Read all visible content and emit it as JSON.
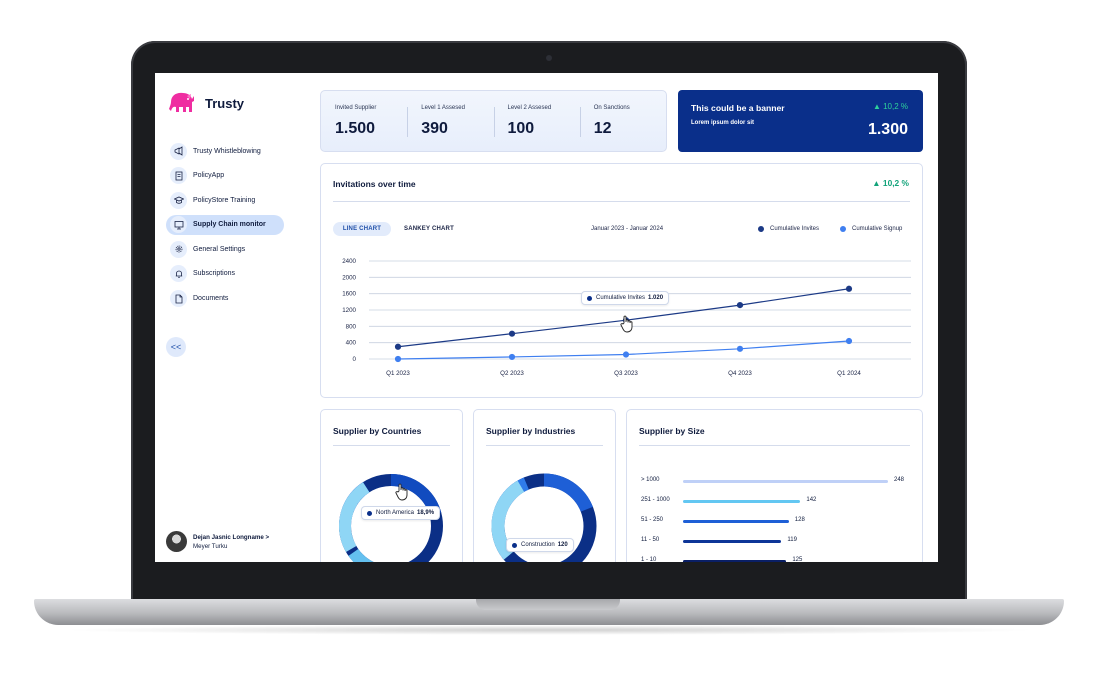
{
  "app": {
    "name": "Trusty"
  },
  "sidebar": {
    "items": [
      {
        "label": "Trusty Whistleblowing",
        "icon": "megaphone-icon",
        "active": false
      },
      {
        "label": "PolicyApp",
        "icon": "document-icon",
        "active": false
      },
      {
        "label": "PolicyStore Training",
        "icon": "graduation-cap-icon",
        "active": false
      },
      {
        "label": "Supply Chain monitor",
        "icon": "monitor-icon",
        "active": true
      },
      {
        "label": "General Settings",
        "icon": "gear-icon",
        "active": false
      },
      {
        "label": "Subscriptions",
        "icon": "bell-icon",
        "active": false
      },
      {
        "label": "Documents",
        "icon": "file-icon",
        "active": false
      }
    ],
    "collapse_label": "<<",
    "user": {
      "name": "Dejan Jasnic Longname >",
      "company": "Meyer Turku"
    }
  },
  "stats": [
    {
      "label": "Invited Supplier",
      "value": "1.500"
    },
    {
      "label": "Level 1 Assesed",
      "value": "390"
    },
    {
      "label": "Level 2 Assesed",
      "value": "100"
    },
    {
      "label": "On Sanctions",
      "value": "12"
    }
  ],
  "banner": {
    "title": "This could be a banner",
    "subtitle": "Lorem ipsum dolor sit",
    "trend": "▲ 10,2 %",
    "value": "1.300"
  },
  "invitations": {
    "title": "Invitations over time",
    "trend": "▲ 10,2 %",
    "tabs": {
      "line": "LINE CHART",
      "sankey": "SANKEY CHART"
    },
    "date_range": "Januar 2023 - Januar 2024",
    "legend": {
      "invites": "Cumulative Invites",
      "signups": "Cumulative Signup"
    },
    "tooltip": {
      "label": "Cumulative Invites",
      "value": "1.020"
    }
  },
  "colors": {
    "navy": "#0a2f8a",
    "dark_series": "#1c3a86",
    "light_series": "#3f7ff0",
    "accent_green": "#12a37a"
  },
  "chart_data": {
    "type": "line",
    "categories": [
      "Q1 2023",
      "Q2 2023",
      "Q3 2023",
      "Q4 2023",
      "Q1 2024"
    ],
    "series": [
      {
        "name": "Cumulative Invites",
        "values": [
          300,
          620,
          950,
          1320,
          1720
        ]
      },
      {
        "name": "Cumulative Signup",
        "values": [
          0,
          50,
          110,
          250,
          440
        ]
      }
    ],
    "yticks": [
      "2400",
      "2000",
      "1600",
      "1200",
      "800",
      "400",
      "0"
    ],
    "ylim": [
      0,
      2400
    ],
    "grid": true,
    "legend": "top-right"
  },
  "countries": {
    "title": "Supplier by Countries",
    "tooltip_label": "North America",
    "tooltip_value": "18,9%"
  },
  "industries": {
    "title": "Supplier by Industries",
    "tooltip_label": "Construction",
    "tooltip_value": "120"
  },
  "sizes": {
    "title": "Supplier by Size",
    "rows": [
      {
        "label": "> 1000",
        "value": "248",
        "color": "#bfd0f7"
      },
      {
        "label": "251 - 1000",
        "value": "142",
        "color": "#63c7f2"
      },
      {
        "label": "51 - 250",
        "value": "128",
        "color": "#1e5fd6"
      },
      {
        "label": "11 - 50",
        "value": "119",
        "color": "#0d3597"
      },
      {
        "label": "1 - 10",
        "value": "125",
        "color": "#0a1f66"
      }
    ]
  }
}
